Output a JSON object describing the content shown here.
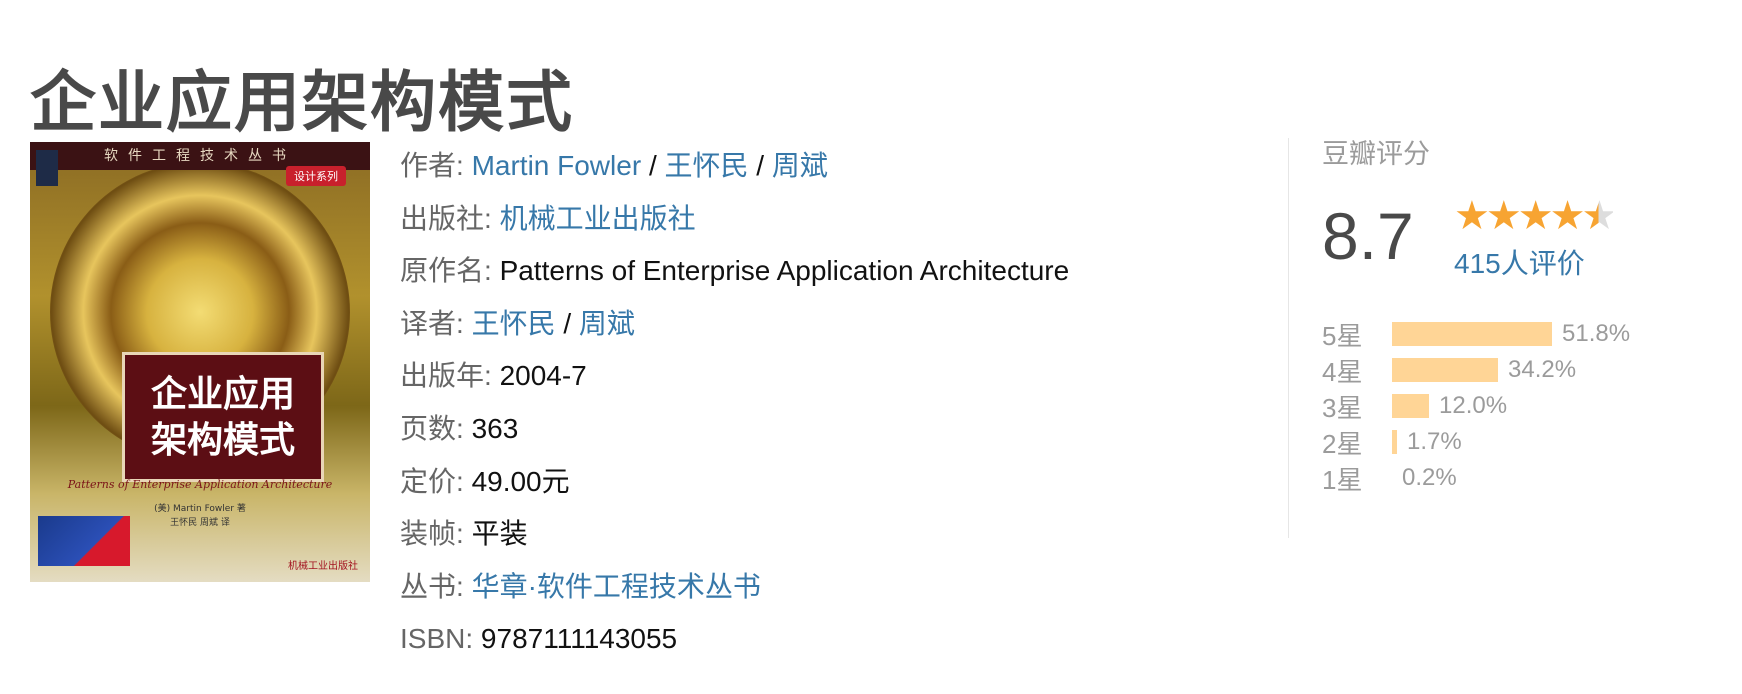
{
  "book": {
    "title": "企业应用架构模式"
  },
  "cover": {
    "top_text": "软件工程技术丛书",
    "series_tag": "设计系列",
    "title_line1": "企业应用",
    "title_line2": "架构模式",
    "english_title": "Patterns of Enterprise Application Architecture",
    "authors": "(美) Martin Fowler 著",
    "translators": "王怀民 周斌 译",
    "publisher_mark": "机械工业出版社"
  },
  "info": {
    "author_label": "作者:",
    "authors": [
      "Martin Fowler",
      "王怀民",
      "周斌"
    ],
    "publisher_label": "出版社:",
    "publisher": "机械工业出版社",
    "original_title_label": "原作名:",
    "original_title": "Patterns of Enterprise Application Architecture",
    "translator_label": "译者:",
    "translators": [
      "王怀民",
      "周斌"
    ],
    "pub_year_label": "出版年:",
    "pub_year": "2004-7",
    "pages_label": "页数:",
    "pages": "363",
    "price_label": "定价:",
    "price": "49.00元",
    "binding_label": "装帧:",
    "binding": "平装",
    "series_label": "丛书:",
    "series": "华章·软件工程技术丛书",
    "isbn_label": "ISBN:",
    "isbn": "9787111143055",
    "separator": "/"
  },
  "rating": {
    "heading": "豆瓣评分",
    "score": "8.7",
    "stars_value": 4.5,
    "votes": "415人评价",
    "distribution": [
      {
        "label": "5星",
        "pct": "51.8%",
        "value": 51.8
      },
      {
        "label": "4星",
        "pct": "34.2%",
        "value": 34.2
      },
      {
        "label": "3星",
        "pct": "12.0%",
        "value": 12.0
      },
      {
        "label": "2星",
        "pct": "1.7%",
        "value": 1.7
      },
      {
        "label": "1星",
        "pct": "0.2%",
        "value": 0.2
      }
    ],
    "colors": {
      "star": "#f7a432",
      "bar": "#ffd596",
      "link": "#3778a9"
    }
  }
}
